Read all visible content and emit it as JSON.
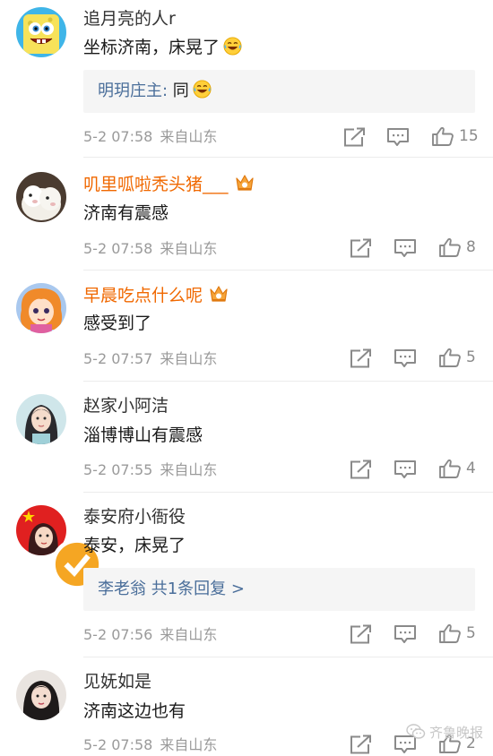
{
  "comments": [
    {
      "username": "追月亮的人r",
      "text": "坐标济南，床晃了",
      "reply_name": "明玥庄主:",
      "reply_text": " 同",
      "time": "5-2 07:58",
      "source": "来自山东",
      "likes": "15"
    },
    {
      "username": "叽里呱啦秃头猪___",
      "text": "济南有震感",
      "time": "5-2 07:58",
      "source": "来自山东",
      "likes": "8"
    },
    {
      "username": "早晨吃点什么呢",
      "text": "感受到了",
      "time": "5-2 07:57",
      "source": "来自山东",
      "likes": "5"
    },
    {
      "username": "赵家小阿洁",
      "text": "淄博博山有震感",
      "time": "5-2 07:55",
      "source": "来自山东",
      "likes": "4"
    },
    {
      "username": "泰安府小衙役",
      "text": "泰安，床晃了",
      "reply_summary": "李老翁  共1条回复 >",
      "time": "5-2 07:56",
      "source": "来自山东",
      "likes": "5"
    },
    {
      "username": "见妩如是",
      "text": "济南这边也有",
      "time": "5-2 07:58",
      "source": "来自山东",
      "likes": "2"
    }
  ],
  "watermark": "齐鲁晚报",
  "colors": {
    "vip_name": "#f06800",
    "reply_link": "#4a6e9a",
    "meta_gray": "#9a9a9a"
  },
  "icons": [
    "share-icon",
    "comment-icon",
    "like-icon",
    "crown-icon",
    "laugh-cry-emoji",
    "verified-badge-icon",
    "wechat-icon"
  ]
}
